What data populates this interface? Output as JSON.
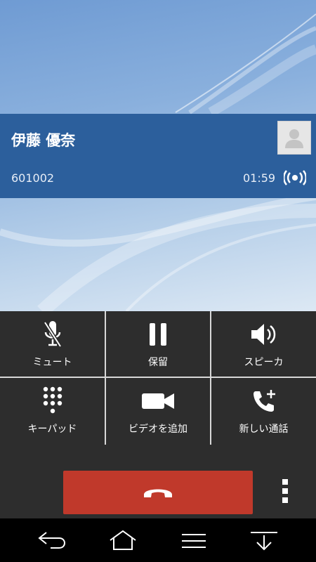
{
  "call": {
    "caller_name": "伊藤 優奈",
    "caller_number": "601002",
    "timer": "01:59"
  },
  "controls": [
    {
      "label": "ミュート",
      "icon": "mic-off-icon"
    },
    {
      "label": "保留",
      "icon": "pause-icon"
    },
    {
      "label": "スピーカ",
      "icon": "speaker-icon"
    },
    {
      "label": "キーパッド",
      "icon": "keypad-icon"
    },
    {
      "label": "ビデオを追加",
      "icon": "video-camera-icon"
    },
    {
      "label": "新しい通話",
      "icon": "add-call-icon"
    }
  ],
  "colors": {
    "call_card": "#2c5f9c",
    "end_call": "#c0392b",
    "panel": "#2d2d2d"
  },
  "navbar": [
    "back-icon",
    "home-icon",
    "menu-icon",
    "recent-down-icon"
  ]
}
